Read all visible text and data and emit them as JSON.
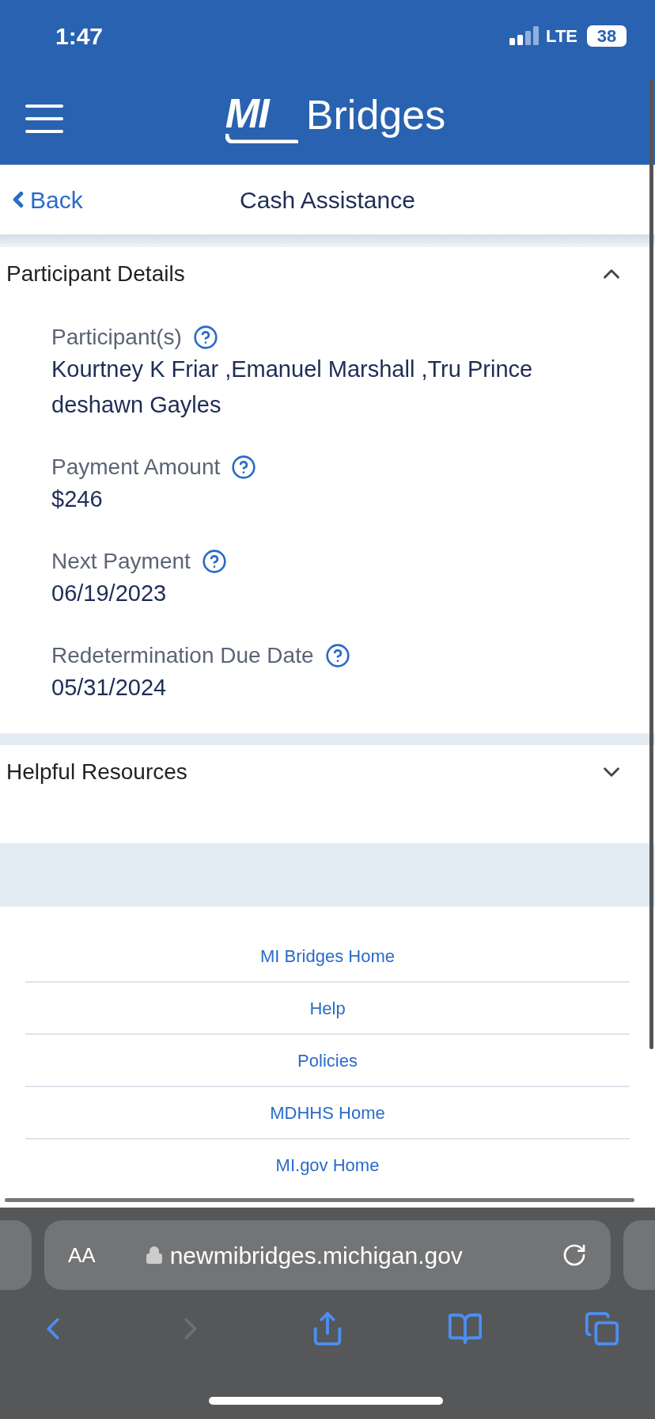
{
  "status_bar": {
    "time": "1:47",
    "network": "LTE",
    "battery": "38"
  },
  "header": {
    "logo_mark": "MI",
    "logo_name": "Bridges"
  },
  "nav": {
    "back": "Back",
    "title": "Cash Assistance"
  },
  "sections": [
    {
      "title": "Participant Details",
      "expanded": true,
      "fields": [
        {
          "label": "Participant(s)",
          "value": "Kourtney K Friar ,Emanuel Marshall ,Tru Prince deshawn Gayles"
        },
        {
          "label": "Payment Amount",
          "value": "$246"
        },
        {
          "label": "Next Payment",
          "value": "06/19/2023"
        },
        {
          "label": "Redetermination Due Date",
          "value": "05/31/2024"
        }
      ]
    },
    {
      "title": "Helpful Resources",
      "expanded": false
    }
  ],
  "footer_links": [
    "MI Bridges Home",
    "Help",
    "Policies",
    "MDHHS Home",
    "MI.gov Home"
  ],
  "browser": {
    "text_size": "AA",
    "url": "newmibridges.michigan.gov"
  }
}
